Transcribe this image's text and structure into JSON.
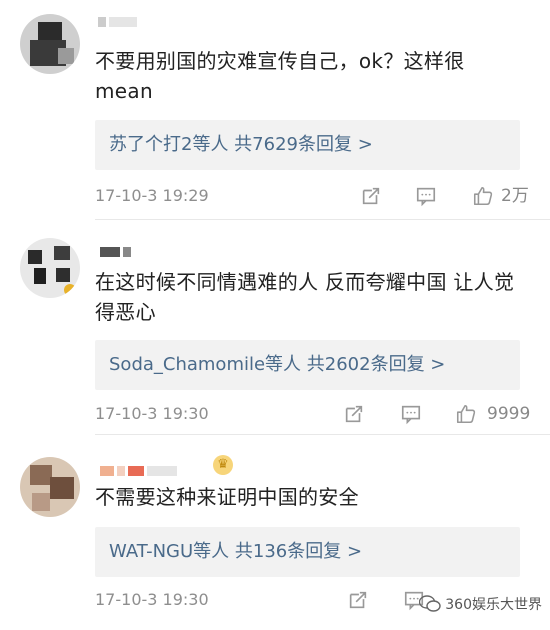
{
  "comments": [
    {
      "text": "不要用别国的灾难宣传自己，ok？这样很mean",
      "reply_summary": "苏了个打2等人 共7629条回复 >",
      "timestamp": "17-10-3 19:29",
      "likes": "2万"
    },
    {
      "text": "在这时候不同情遇难的人 反而夸耀中国 让人觉得恶心",
      "reply_summary": "Soda_Chamomile等人 共2602条回复 >",
      "timestamp": "17-10-3 19:30",
      "likes": "9999"
    },
    {
      "text": "不需要这种来证明中国的安全",
      "reply_summary": "WAT-NGU等人 共136条回复 >",
      "timestamp": "17-10-3 19:30",
      "likes": ""
    }
  ],
  "watermark": "360娱乐大世界",
  "colors": {
    "reply_link": "#4a6a8a",
    "meta_text": "#8e8e8e",
    "reply_bg": "#f2f2f2"
  }
}
